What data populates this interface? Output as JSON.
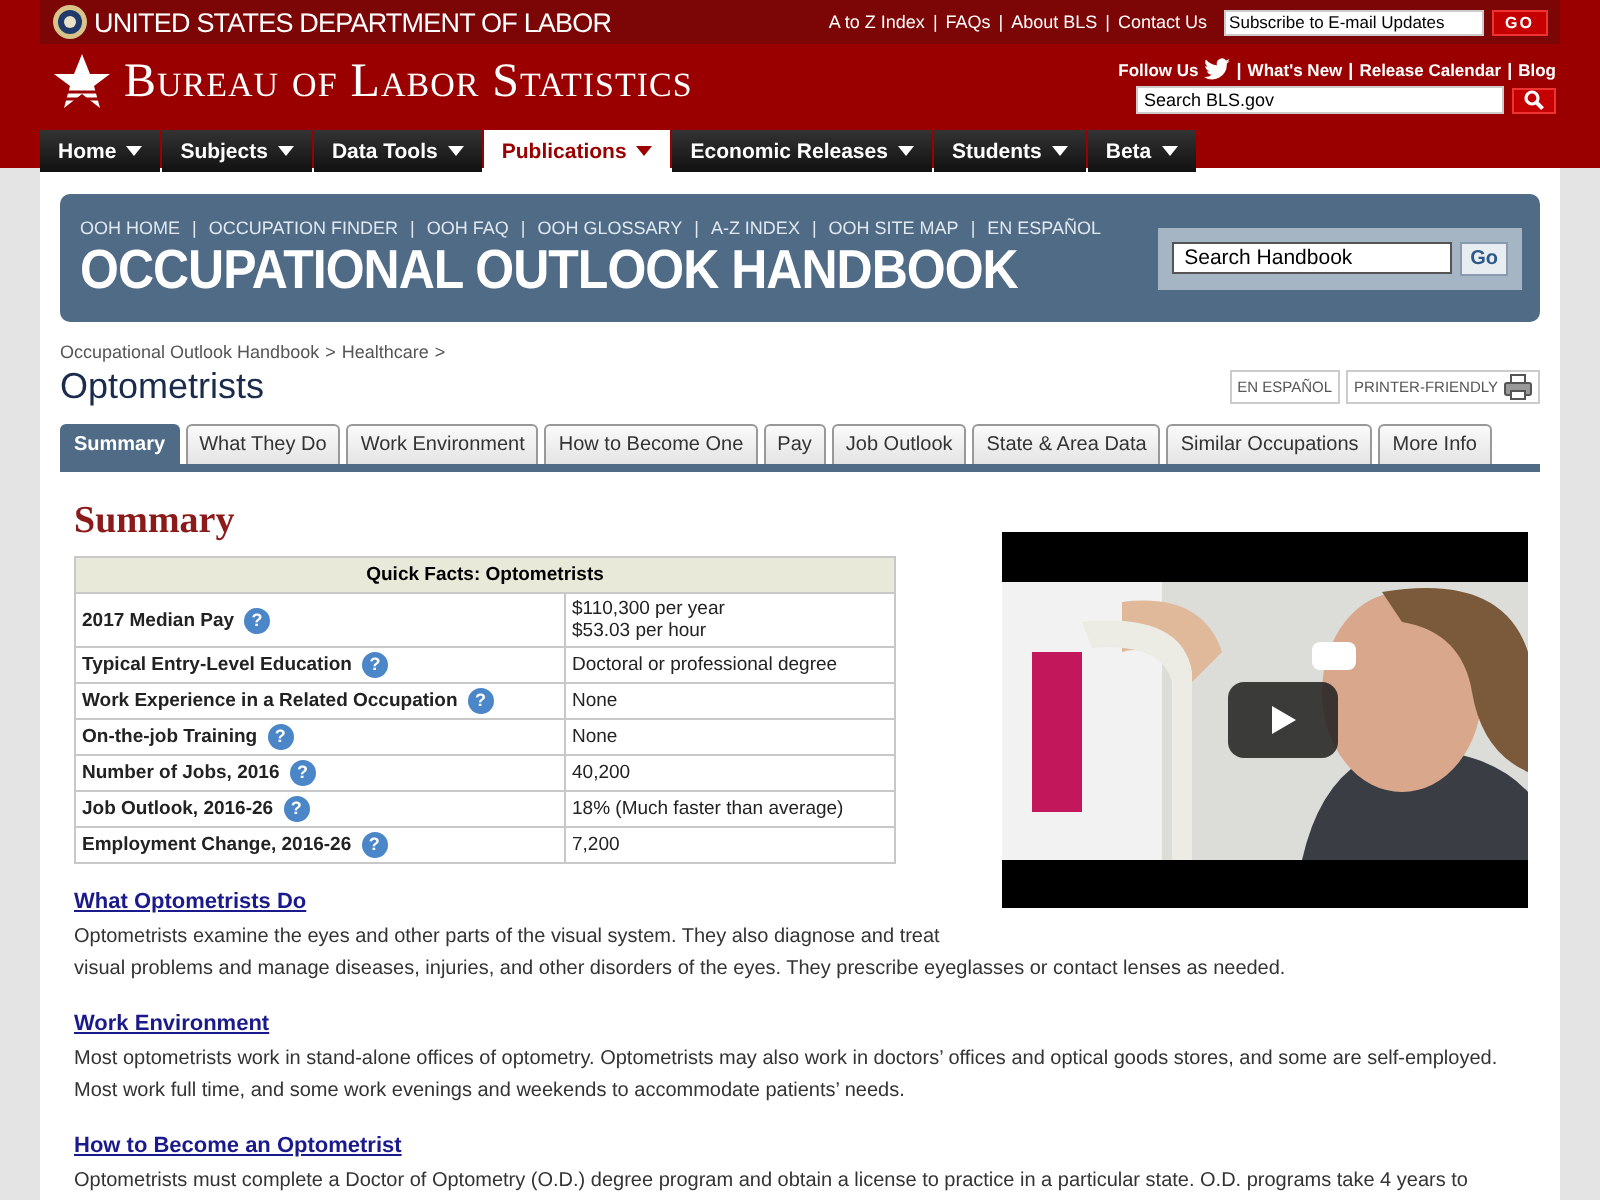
{
  "agency": {
    "name": "UNITED STATES DEPARTMENT OF LABOR"
  },
  "link_separator": "|",
  "top_links": [
    "A to Z Index",
    "FAQs",
    "About BLS",
    "Contact Us"
  ],
  "subscribe": {
    "placeholder": "Subscribe to E-mail Updates",
    "button": "GO"
  },
  "site_title": "Bureau of Labor Statistics",
  "follow": {
    "label": "Follow Us",
    "links": [
      "What's New",
      "Release Calendar",
      "Blog"
    ]
  },
  "site_search": {
    "placeholder": "Search BLS.gov"
  },
  "nav": [
    {
      "label": "Home",
      "selected": false
    },
    {
      "label": "Subjects",
      "selected": false
    },
    {
      "label": "Data Tools",
      "selected": false
    },
    {
      "label": "Publications",
      "selected": true
    },
    {
      "label": "Economic Releases",
      "selected": false
    },
    {
      "label": "Students",
      "selected": false
    },
    {
      "label": "Beta",
      "selected": false
    }
  ],
  "ooh": {
    "links": [
      "OOH HOME",
      "OCCUPATION FINDER",
      "OOH FAQ",
      "OOH GLOSSARY",
      "A-Z INDEX",
      "OOH SITE MAP",
      "EN ESPAÑOL"
    ],
    "title": "OCCUPATIONAL OUTLOOK HANDBOOK",
    "search": {
      "placeholder": "Search Handbook",
      "button": "Go"
    }
  },
  "breadcrumb": {
    "items": [
      "Occupational Outlook Handbook",
      "Healthcare"
    ],
    "separator": ">"
  },
  "page_title": "Optometrists",
  "page_tools": {
    "language": "EN ESPAÑOL",
    "print": "PRINTER-FRIENDLY"
  },
  "tabs": [
    {
      "label": "Summary",
      "selected": true
    },
    {
      "label": "What They Do",
      "selected": false
    },
    {
      "label": "Work Environment",
      "selected": false
    },
    {
      "label": "How to Become One",
      "selected": false
    },
    {
      "label": "Pay",
      "selected": false
    },
    {
      "label": "Job Outlook",
      "selected": false
    },
    {
      "label": "State & Area Data",
      "selected": false
    },
    {
      "label": "Similar Occupations",
      "selected": false
    },
    {
      "label": "More Info",
      "selected": false
    }
  ],
  "summary": {
    "heading": "Summary",
    "quick_facts": {
      "title": "Quick Facts: Optometrists",
      "rows": [
        {
          "label": "2017 Median Pay",
          "help": "?",
          "value": [
            "$110,300 per year",
            "$53.03 per hour"
          ]
        },
        {
          "label": "Typical Entry-Level Education",
          "help": "?",
          "value": [
            "Doctoral or professional degree"
          ]
        },
        {
          "label": "Work Experience in a Related Occupation",
          "help": "?",
          "value": [
            "None"
          ]
        },
        {
          "label": "On-the-job Training",
          "help": "?",
          "value": [
            "None"
          ]
        },
        {
          "label": "Number of Jobs, 2016",
          "help": "?",
          "value": [
            "40,200"
          ]
        },
        {
          "label": "Job Outlook, 2016-26",
          "help": "?",
          "value": [
            "18% (Much faster than average)"
          ]
        },
        {
          "label": "Employment Change, 2016-26",
          "help": "?",
          "value": [
            "7,200"
          ]
        }
      ]
    }
  },
  "sections": [
    {
      "heading": "What Optometrists Do",
      "text": "Optometrists examine the eyes and other parts of the visual system. They also diagnose and treat visual problems and manage diseases, injuries, and other disorders of the eyes. They prescribe eyeglasses or contact lenses as needed."
    },
    {
      "heading": "Work Environment",
      "text": "Most optometrists work in stand-alone offices of optometry. Optometrists may also work in doctors’ offices and optical goods stores, and some are self-employed. Most work full time, and some work evenings and weekends to accommodate patients’ needs."
    },
    {
      "heading": "How to Become an Optometrist",
      "text": "Optometrists must complete a Doctor of Optometry (O.D.) degree program and obtain a license to practice in a particular state. O.D. programs take 4 years to"
    }
  ]
}
